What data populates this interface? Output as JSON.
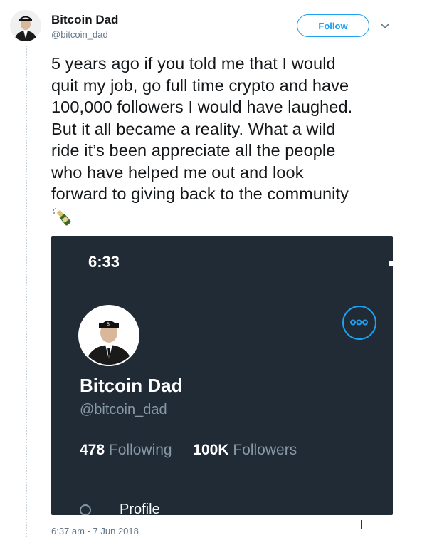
{
  "tweet": {
    "author": {
      "display_name": "Bitcoin Dad",
      "handle": "@bitcoin_dad",
      "avatar_icon": "user-avatar-icon"
    },
    "follow_label": "Follow",
    "menu_icon": "chevron-down-icon",
    "text": "5 years ago if you told me that I would\nquit my job, go full time crypto and have\n100,000 followers I would have laughed.\nBut it all became a reality. What a wild\nride it’s been appreciate all the people\nwho have helped me out and look\nforward to giving back to the community",
    "emoji_icon": "champagne-icon",
    "timestamp": "6:37 am - 7 Jun 2018"
  },
  "embedded_screenshot": {
    "status_time": "6:33",
    "profile": {
      "display_name": "Bitcoin Dad",
      "handle": "@bitcoin_dad",
      "following_count": "478",
      "following_label": "Following",
      "followers_count": "100K",
      "followers_label": "Followers"
    },
    "tab_label": "Profile",
    "more_icon": "more-options-icon"
  },
  "colors": {
    "accent": "#1da1f2",
    "card_background": "#212b36",
    "muted_text": "#657786"
  }
}
